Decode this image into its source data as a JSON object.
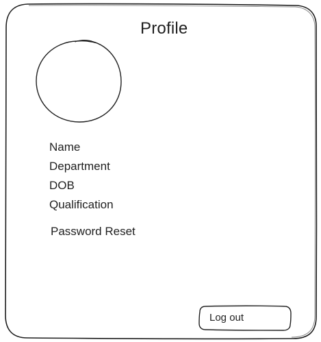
{
  "profile": {
    "title": "Profile",
    "fields": {
      "name": "Name",
      "department": "Department",
      "dob": "DOB",
      "qualification": "Qualification"
    },
    "password_reset_label": "Password Reset",
    "logout_label": "Log out"
  },
  "colors": {
    "ink": "#1e1e1e",
    "background": "#ffffff"
  },
  "icons": {
    "avatar": "avatar-circle-placeholder"
  }
}
